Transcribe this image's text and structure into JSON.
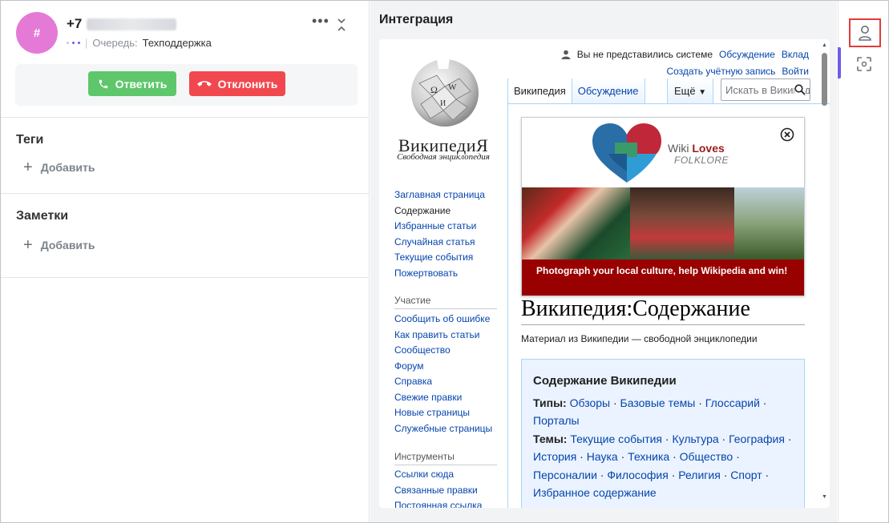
{
  "call": {
    "avatar_symbol": "#",
    "phone_prefix": "+7",
    "queue_label": "Очередь:",
    "queue_value": "Техподдержка",
    "answer_label": "Ответить",
    "decline_label": "Отклонить",
    "more_icon": "ellipsis-icon",
    "collapse_icon": "collapse-icon"
  },
  "tags": {
    "title": "Теги",
    "add_label": "Добавить"
  },
  "notes": {
    "title": "Заметки",
    "add_label": "Добавить"
  },
  "integration": {
    "title": "Интеграция",
    "wiki": {
      "wordmark": "ВикипедиЯ",
      "tagline": "Свободная энциклопедия",
      "user": {
        "not_logged_in": "Вы не представились системе",
        "talk": "Обсуждение",
        "contributions": "Вклад",
        "create_account": "Создать учётную запись",
        "login": "Войти"
      },
      "tabs": {
        "wikipedia": "Википедия",
        "discussion": "Обсуждение",
        "more": "Ещё"
      },
      "search_placeholder": "Искать в Википедии",
      "nav_main": [
        "Заглавная страница",
        "Содержание",
        "Избранные статьи",
        "Случайная статья",
        "Текущие события",
        "Пожертвовать"
      ],
      "nav_participation_title": "Участие",
      "nav_participation": [
        "Сообщить об ошибке",
        "Как править статьи",
        "Сообщество",
        "Форум",
        "Справка",
        "Свежие правки",
        "Новые страницы",
        "Служебные страницы"
      ],
      "nav_tools_title": "Инструменты",
      "nav_tools": [
        "Ссылки сюда",
        "Связанные правки",
        "Постоянная ссылка"
      ],
      "banner": {
        "wiki": "Wiki",
        "loves": "Loves",
        "folklore": "FOLKLORE",
        "message": "Photograph your local culture, help Wikipedia and win!"
      },
      "page_title": "Википедия:Содержание",
      "page_subtitle": "Материал из Википедии — свободной энциклопедии",
      "toc": {
        "title": "Содержание Википедии",
        "types_label": "Типы:",
        "types": [
          "Обзоры",
          "Базовые темы",
          "Глоссарий",
          "Порталы"
        ],
        "topics_label": "Темы:",
        "topics": [
          "Текущие события",
          "Культура",
          "География",
          "История",
          "Наука",
          "Техника",
          "Общество",
          "Персоналии",
          "Философия",
          "Религия",
          "Спорт",
          "Избранное содержание"
        ]
      }
    }
  },
  "rail": {
    "user_icon": "user-icon",
    "scan_icon": "scan-icon"
  },
  "colors": {
    "accent": "#6c5ce7",
    "answer": "#5ec76b",
    "decline": "#f0484e",
    "avatar": "#e57ad6",
    "highlight": "#e33b3b"
  }
}
